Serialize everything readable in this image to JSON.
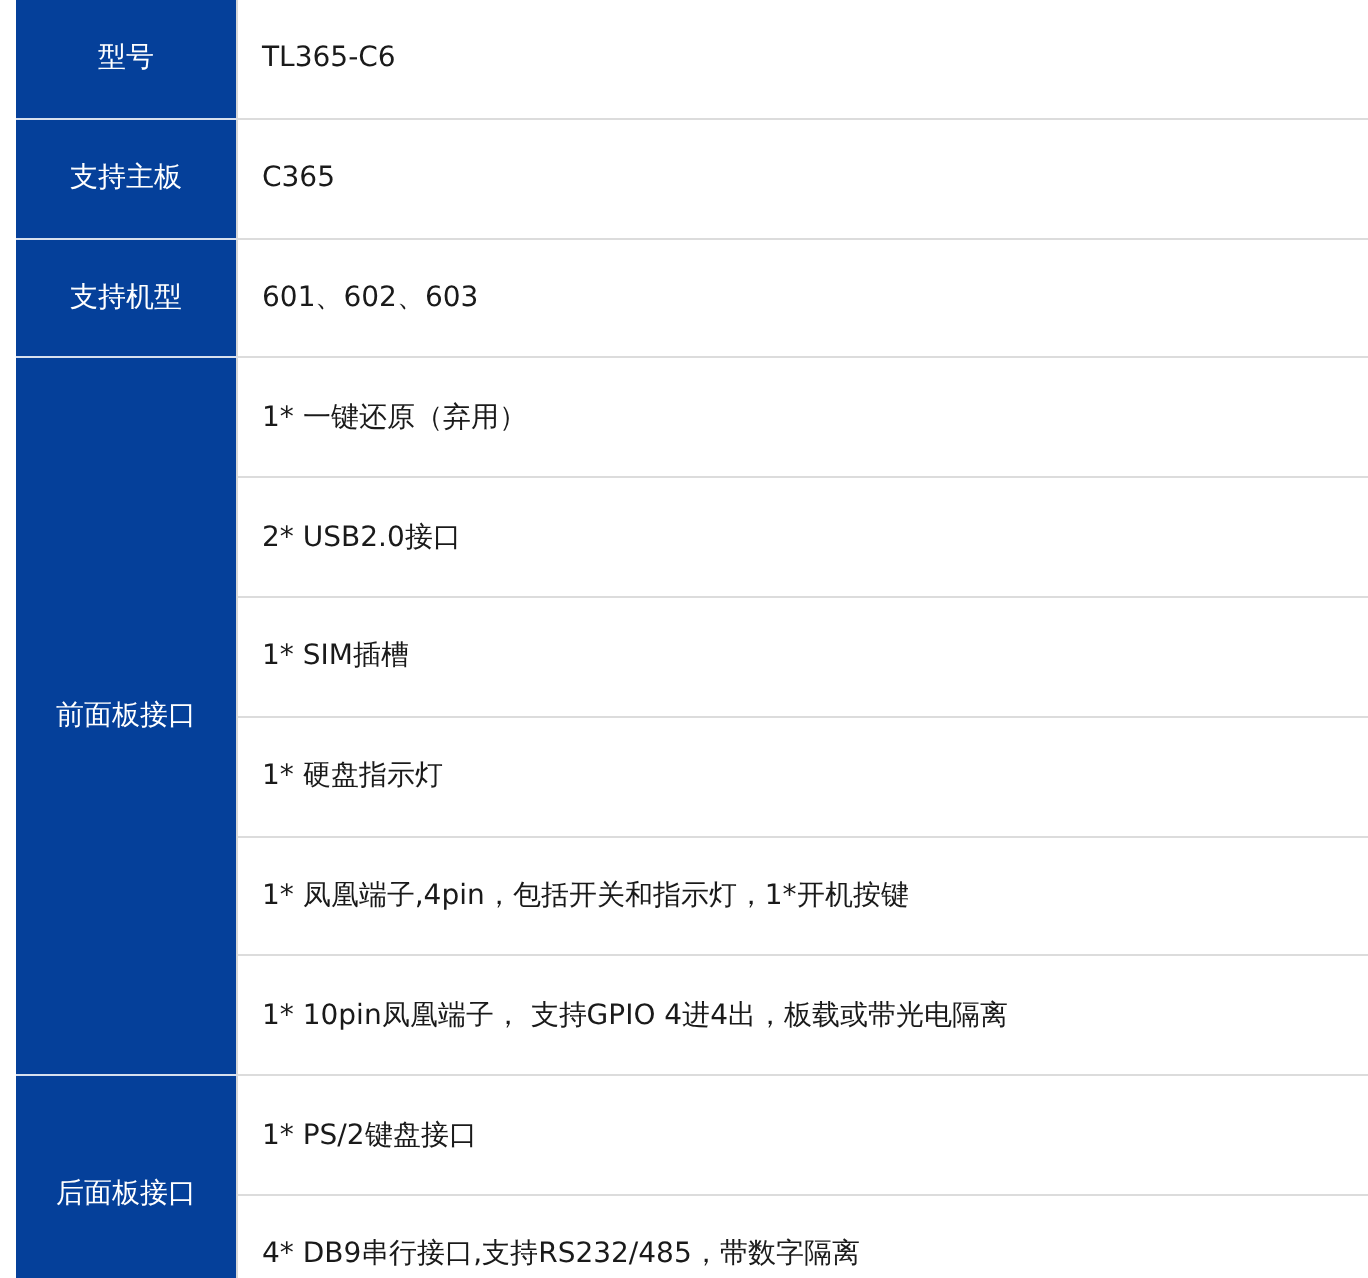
{
  "spec_table": {
    "rows": [
      {
        "label": "型号",
        "values": [
          "TL365-C6"
        ]
      },
      {
        "label": "支持主板",
        "values": [
          "C365"
        ]
      },
      {
        "label": "支持机型",
        "values": [
          "601、602、603"
        ]
      },
      {
        "label": "前面板接口",
        "values": [
          "1* 一键还原（弃用）",
          "2* USB2.0接口",
          "1* SIM插槽",
          "1* 硬盘指示灯",
          "1* 凤凰端子,4pin，包括开关和指示灯，1*开机按键",
          "1* 10pin凤凰端子， 支持GPIO 4进4出，板载或带光电隔离"
        ]
      },
      {
        "label": "后面板接口",
        "values": [
          "1* PS/2键盘接口",
          "4* DB9串行接口,支持RS232/485，带数字隔离"
        ]
      }
    ]
  }
}
